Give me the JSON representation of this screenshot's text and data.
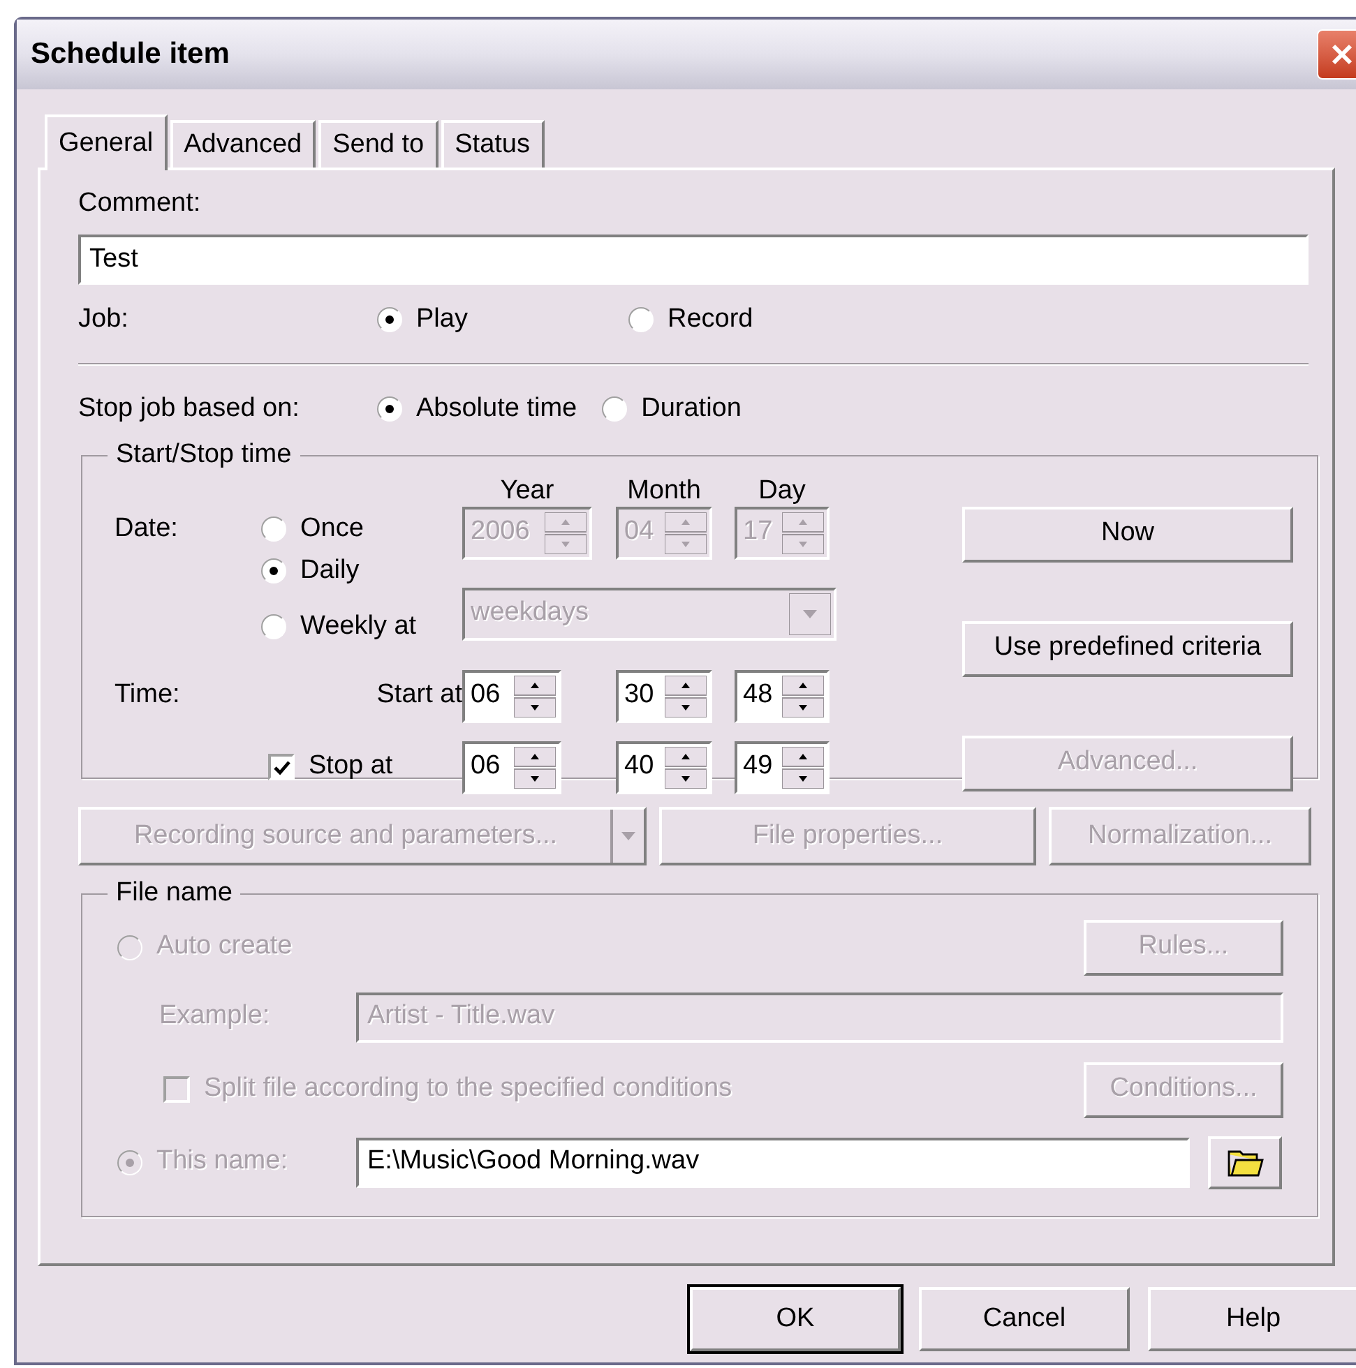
{
  "window": {
    "title": "Schedule item"
  },
  "tabs": [
    {
      "label": "General",
      "selected": true
    },
    {
      "label": "Advanced",
      "selected": false
    },
    {
      "label": "Send to",
      "selected": false
    },
    {
      "label": "Status",
      "selected": false
    }
  ],
  "comment": {
    "label": "Comment:",
    "value": "Test"
  },
  "job": {
    "label": "Job:",
    "options": [
      {
        "label": "Play",
        "selected": true
      },
      {
        "label": "Record",
        "selected": false
      }
    ]
  },
  "stop_job": {
    "label": "Stop job based on:",
    "options": [
      {
        "label": "Absolute time",
        "selected": true
      },
      {
        "label": "Duration",
        "selected": false
      }
    ]
  },
  "start_stop": {
    "title": "Start/Stop time",
    "date_label": "Date:",
    "date_options": [
      {
        "label": "Once",
        "selected": false
      },
      {
        "label": "Daily",
        "selected": true
      },
      {
        "label": "Weekly at",
        "selected": false
      }
    ],
    "column_headers": [
      "Year",
      "Month",
      "Day"
    ],
    "date_fields": [
      {
        "value": "2006",
        "disabled": true
      },
      {
        "value": "04",
        "disabled": true
      },
      {
        "value": "17",
        "disabled": true
      }
    ],
    "weekly_select": {
      "value": "weekdays",
      "disabled": true
    },
    "time_label": "Time:",
    "start": {
      "label": "Start at",
      "fields": [
        "06",
        "30",
        "48"
      ]
    },
    "stop": {
      "label": "Stop at",
      "checked": true,
      "fields": [
        "06",
        "40",
        "49"
      ]
    },
    "buttons": [
      {
        "label": "Now",
        "disabled": false
      },
      {
        "label": "Use predefined criteria",
        "disabled": false
      },
      {
        "label": "Advanced...",
        "disabled": true
      }
    ]
  },
  "action_buttons": [
    {
      "label": "Recording source and parameters...",
      "kind": "split",
      "disabled": true
    },
    {
      "label": "File properties...",
      "kind": "plain",
      "disabled": true
    },
    {
      "label": "Normalization...",
      "kind": "plain",
      "disabled": true
    }
  ],
  "file_name": {
    "title": "File name",
    "auto_create": {
      "label": "Auto create",
      "selected": false,
      "disabled": true
    },
    "rules_button": {
      "label": "Rules...",
      "disabled": true
    },
    "example": {
      "label": "Example:",
      "value": "Artist - Title.wav",
      "disabled": true
    },
    "split": {
      "label": "Split file according to the specified conditions",
      "checked": false,
      "disabled": true
    },
    "conditions_button": {
      "label": "Conditions...",
      "disabled": true
    },
    "this_name": {
      "label": "This name:",
      "selected": true,
      "disabled": true
    },
    "path": {
      "value": "E:\\Music\\Good Morning.wav"
    }
  },
  "footer_buttons": [
    {
      "label": "OK",
      "default": true
    },
    {
      "label": "Cancel",
      "default": false
    },
    {
      "label": "Help",
      "default": false
    }
  ]
}
